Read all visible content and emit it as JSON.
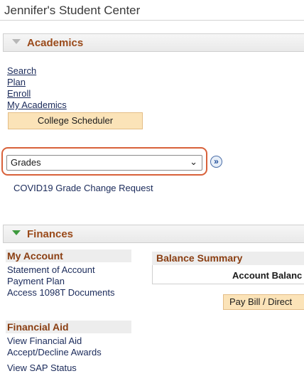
{
  "page": {
    "title": "Jennifer's Student Center"
  },
  "academics": {
    "header": "Academics",
    "links": [
      "Search",
      "Plan",
      "Enroll",
      "My Academics"
    ],
    "scheduler_button": "College Scheduler",
    "dropdown": {
      "selected": "Grades"
    },
    "covid_link": "COVID19 Grade Change Request"
  },
  "finances": {
    "header": "Finances",
    "my_account": {
      "title": "My Account",
      "links": [
        "Statement of Account",
        "Payment Plan",
        "Access 1098T Documents"
      ]
    },
    "balance_summary": {
      "title": "Balance Summary",
      "column_header": "Account Balanc",
      "pay_button": "Pay Bill / Direct"
    },
    "financial_aid": {
      "title": "Financial Aid",
      "links": [
        "View Financial Aid",
        "Accept/Decline Awards",
        "View SAP Status"
      ]
    }
  },
  "colors": {
    "section_label": "#9a4a1a",
    "focus_ring": "#d8613a",
    "button_bg": "#fbe3b8"
  },
  "icons": {
    "academics_toggle": "triangle-down-icon",
    "finances_toggle": "triangle-down-icon",
    "go": "double-chevron-right-icon"
  }
}
